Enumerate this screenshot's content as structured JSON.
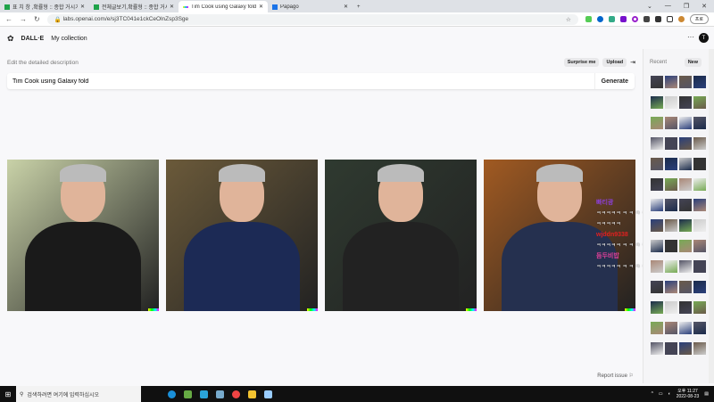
{
  "browser": {
    "tabs": [
      {
        "title": "표 치 창 ,확률형 :: 종합 거시기"
      },
      {
        "title": "전체글보기,확률형 :: 종합 거시기"
      },
      {
        "title": "Tim Cook using Galaxy fold | DALL·E"
      },
      {
        "title": "Papago"
      }
    ],
    "url": "labs.openai.com/e/sj3TC041e1ckCeOlnZsp3Sge",
    "profile": "프로"
  },
  "app": {
    "brand": "DALL·E",
    "nav": "My collection",
    "avatar": "T",
    "more": "···"
  },
  "editor": {
    "label": "Edit the detailed description",
    "surprise": "Surprise me",
    "upload": "Upload",
    "prompt": "Tim Cook using Galaxy fold",
    "generate": "Generate"
  },
  "report": "Report issue ⚐",
  "sidebar": {
    "title": "Recent",
    "new": "New"
  },
  "overlay": {
    "lines": [
      "빠티광",
      "ㅋㅋㅋㅋㅋ ㅋ ㅋ ㅋ ㅋ ㅋ ㅋ",
      "ㅋㅋㅋㅋㅋ",
      "wjddn9338",
      "ㅋㅋㅋㅋㅋ ㅋ ㅋ ㅋ ㅋ ㅋ",
      "듬두비밥",
      "ㅋㅋㅋㅋㅋ ㅋ ㅋ ㅋ ㅋ ㅋ ㅋ"
    ],
    "colors": [
      "#8a3fd1",
      "#fff",
      "#fff",
      "#e02020",
      "#fff",
      "#e0409a",
      "#fff"
    ]
  },
  "images": [
    {
      "bg": "#c9d2a8",
      "body": "#1a1a1a"
    },
    {
      "bg": "#6b5a3a",
      "body": "#1c2a55"
    },
    {
      "bg": "#2f3a30",
      "body": "#222"
    },
    {
      "bg": "#a15a22",
      "body": "#25304f"
    }
  ],
  "taskbar": {
    "search": "검색하려면 여기에 입력하십시오",
    "time": "오후 11:27",
    "date": "2022-08-23"
  }
}
